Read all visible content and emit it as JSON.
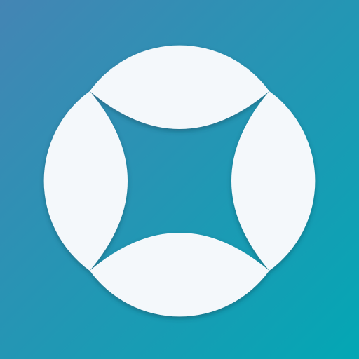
{
  "app_icon": {
    "icon": "rounded-square-in-circle-logo-icon",
    "colors": {
      "background_top_left": "#4485B4",
      "background_bottom_right": "#03A7B4",
      "mark_fill": "#F4F8FB",
      "shadow": "#1A3F52"
    }
  }
}
